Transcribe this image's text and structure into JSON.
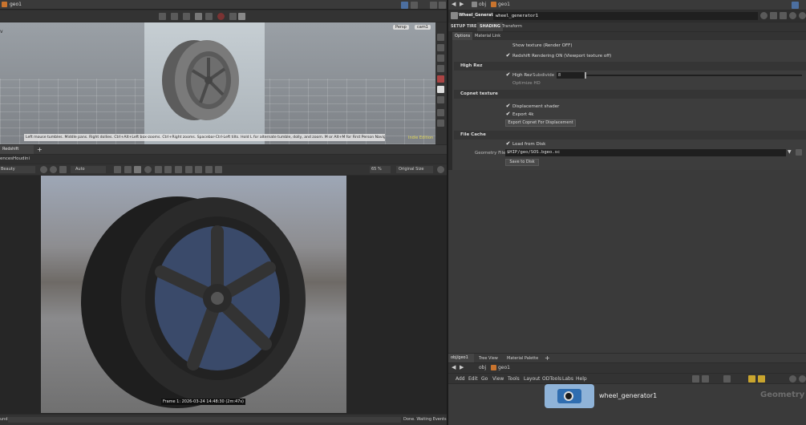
{
  "top_left": {
    "path": "geo1",
    "viewport_menus": [
      "Persp",
      "cam1"
    ],
    "hint": "Left mouse tumbles. Middle pans. Right dollies. Ctrl+Alt+Left box-zooms. Ctrl+Right zooms. Spacebar-Ctrl-Left tilts. Hold L for alternate tumble, dolly, and zoom. M or Alt+M for First Person Navigation.",
    "edition": "Indie Edition"
  },
  "renderview": {
    "tab": "Redshift RenderView",
    "sub_labels": [
      "ences",
      "Houdini"
    ],
    "aov": "Beauty",
    "mode": "Auto",
    "zoom": "65 %",
    "size": "Original Size",
    "frame_info": "Frame 1: 2026-03-24 14:48:30 (2m:47s)",
    "status_left": "und",
    "status_right": "Done. Waiting Events"
  },
  "params": {
    "path": [
      "obj",
      "geo1"
    ],
    "node_type": "Wheel_Generator",
    "node_name": "wheel_generator1",
    "tabs": [
      "SETUP TIRE",
      "SHADING",
      "Transform"
    ],
    "subtabs": [
      "Options",
      "Material Link"
    ],
    "show_texture": "Show texture (Render OFF)",
    "redshift_on": "Redshift Rendering ON (Viewport texture off)",
    "sec_highrez": "High Rez",
    "high_rez": "High Rez",
    "subdivide": "Subdivide",
    "subdivide_val": "8",
    "optimize": "Optimize HD",
    "sec_copnet": "Copnet texture",
    "disp_shader": "Displacement shader",
    "export4k": "Export 4k",
    "export_btn": "Export Copnet For Displacement",
    "sec_filecache": "File Cache",
    "load_disk": "Load from Disk",
    "geo_file_label": "Geometry File",
    "geo_file": "$HIP/geo/SOS.bgeo.sc",
    "save_btn": "Save to Disk"
  },
  "network": {
    "tabs": [
      "obj/geo1",
      "Tree View",
      "Material Palette"
    ],
    "path": [
      "obj",
      "geo1"
    ],
    "menu": [
      "Add",
      "Edit",
      "Go",
      "View",
      "Tools",
      "Layout",
      "ODTools",
      "Labs",
      "Help"
    ],
    "node_label": "wheel_generator1",
    "context": "Geometry"
  }
}
